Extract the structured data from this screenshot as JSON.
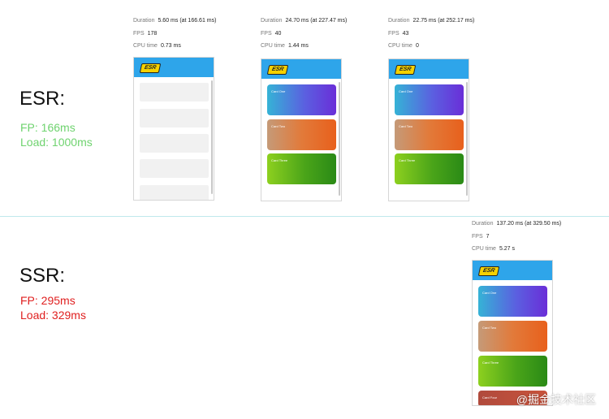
{
  "esr": {
    "heading": "ESR:",
    "fp": "FP: 166ms",
    "load": "Load: 1000ms",
    "color": "#6fd36f"
  },
  "ssr": {
    "heading": "SSR:",
    "fp": "FP: 295ms",
    "load": "Load: 329ms",
    "color": "#e02020"
  },
  "labels": {
    "duration": "Duration",
    "fps": "FPS",
    "cpu": "CPU time"
  },
  "logo_text": "ESR",
  "frames": [
    {
      "duration": "5.60 ms (at 166.61 ms)",
      "fps": "178",
      "cpu": "0.73 ms"
    },
    {
      "duration": "24.70 ms (at 227.47 ms)",
      "fps": "40",
      "cpu": "1.44 ms",
      "cards": [
        "Card One",
        "Card Two",
        "Card Three"
      ]
    },
    {
      "duration": "22.75 ms (at 252.17 ms)",
      "fps": "43",
      "cpu": "0",
      "cards": [
        "Card One",
        "Card Two",
        "Card Three"
      ]
    },
    {
      "duration": "137.20 ms (at 329.50 ms)",
      "fps": "7",
      "cpu": "5.27 s",
      "cards": [
        "Card One",
        "Card Two",
        "Card Three",
        "Card Four"
      ]
    }
  ],
  "watermark": "@掘金技术社区"
}
